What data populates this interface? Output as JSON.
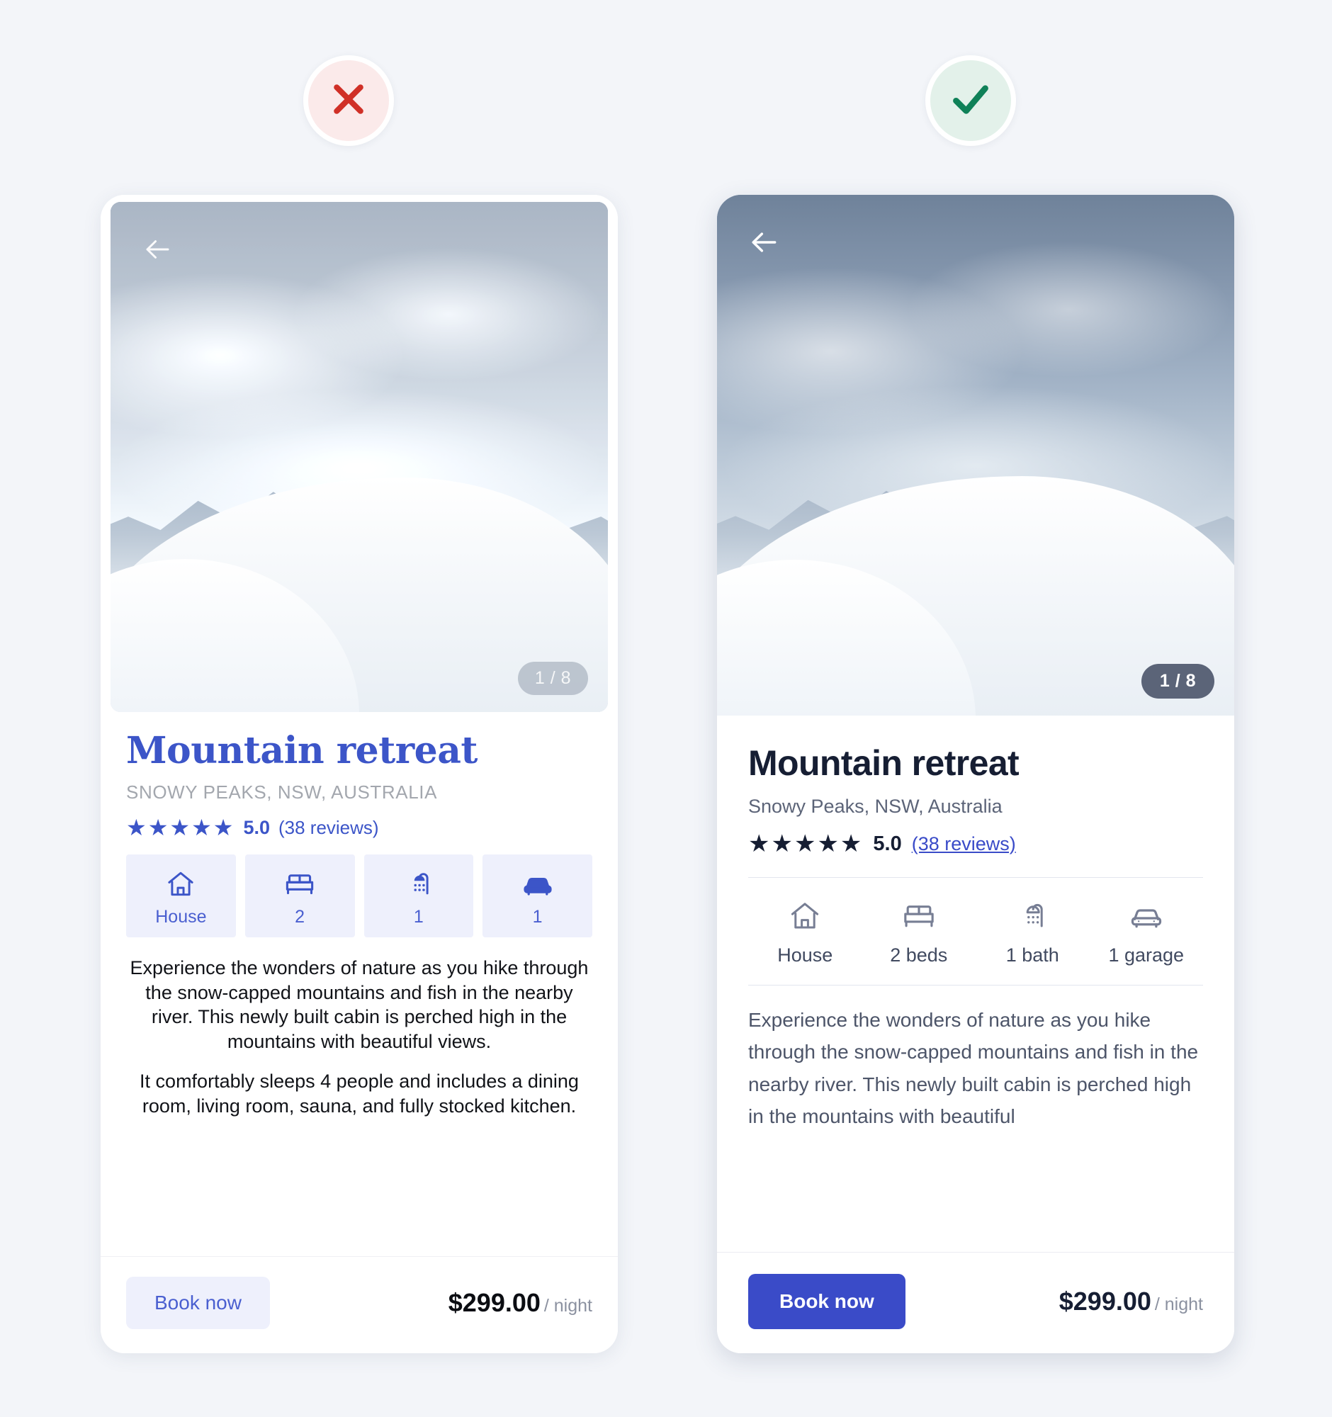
{
  "verdicts": {
    "bad": {
      "icon": "cross-icon",
      "color": "#d03027",
      "bg": "#fbeaea"
    },
    "good": {
      "icon": "check-icon",
      "color": "#0f8158",
      "bg": "#e3f1ea"
    }
  },
  "listing": {
    "title": "Mountain retreat",
    "location_bad": "Snowy Peaks, NSW, Australia",
    "location_good": "Snowy Peaks, NSW, Australia",
    "rating": "5.0",
    "stars": "★★★★★",
    "reviews": "(38 reviews)",
    "image_counter": "1 / 8",
    "back_icon": "back-arrow-icon",
    "price": "$299.00",
    "price_unit": "/ night",
    "book_label": "Book now",
    "paragraph_1": "Experience the wonders of nature as you hike through the snow-capped mountains and fish in the nearby river. This newly built cabin is perched high in the mountains with beautiful views.",
    "paragraph_2": "It comfortably sleeps 4 people and includes a dining room, living room, sauna, and fully stocked kitchen.",
    "paragraph_good": "Experience the wonders of nature as you hike through the snow-capped mountains and fish in the nearby river. This newly built cabin is perched high in the mountains with beautiful"
  },
  "features_bad": [
    {
      "icon": "house-icon",
      "label": "House"
    },
    {
      "icon": "bed-icon",
      "label": "2"
    },
    {
      "icon": "shower-icon",
      "label": "1"
    },
    {
      "icon": "car-icon",
      "label": "1"
    }
  ],
  "features_good": [
    {
      "icon": "house-icon",
      "label": "House"
    },
    {
      "icon": "bed-icon",
      "label": "2 beds"
    },
    {
      "icon": "shower-icon",
      "label": "1 bath"
    },
    {
      "icon": "car-icon",
      "label": "1 garage"
    }
  ],
  "colors": {
    "page_bg": "#f3f5f9",
    "accent_blue": "#3a4bc8",
    "bad_title_blue": "#3c55c8",
    "chip_bg": "#eef0fc",
    "good_title": "#161e33",
    "muted": "#5c6478",
    "counter_good_bg": "#5b6478",
    "error_red": "#d03027",
    "success_green": "#0f8158"
  }
}
